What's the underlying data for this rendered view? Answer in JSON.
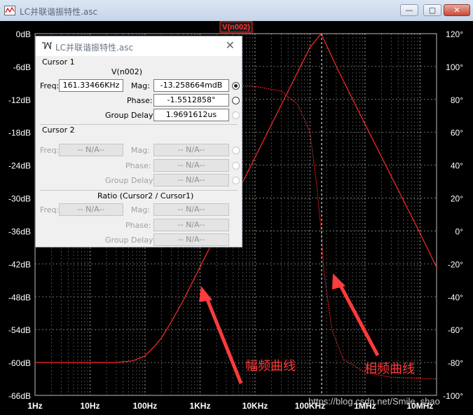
{
  "window": {
    "title": "LC并联谐振特性.asc"
  },
  "titlebar_buttons": {
    "minimize": "—",
    "maximize": "▢",
    "close": "✕"
  },
  "plot": {
    "trace_label": "V(n002)",
    "left_axis": [
      "0dB",
      "-6dB",
      "-12dB",
      "-18dB",
      "-24dB",
      "-30dB",
      "-36dB",
      "-42dB",
      "-48dB",
      "-54dB",
      "-60dB",
      "-66dB"
    ],
    "right_axis": [
      "120°",
      "100°",
      "80°",
      "60°",
      "40°",
      "20°",
      "0°",
      "-20°",
      "-40°",
      "-60°",
      "-80°",
      "-100°"
    ],
    "x_axis": [
      "1Hz",
      "10Hz",
      "100Hz",
      "1KHz",
      "10KHz",
      "100KHz",
      "1MHz",
      "10MHz"
    ],
    "annotations": {
      "mag": "幅频曲线",
      "phase": "相频曲线"
    },
    "watermark": "https://blog.csdn.net/Smile_shao",
    "colors": {
      "trace": "#ff2a2a",
      "annotation": "#ff3b3b",
      "grid": "#8a8a8a",
      "axis_text": "#ffffff"
    }
  },
  "chart_data": {
    "type": "line",
    "x_scale": "log",
    "xlim": [
      1,
      20000000
    ],
    "series": [
      {
        "axis": "left",
        "unit": "dB",
        "ylim": [
          -66,
          0
        ],
        "points": [
          [
            1,
            -60
          ],
          [
            10,
            -60
          ],
          [
            30,
            -60
          ],
          [
            60,
            -59.7
          ],
          [
            100,
            -58.8
          ],
          [
            150,
            -57
          ],
          [
            200,
            -55.5
          ],
          [
            300,
            -52.6
          ],
          [
            500,
            -48.6
          ],
          [
            1000,
            -42.6
          ],
          [
            3000,
            -33
          ],
          [
            10000,
            -22.6
          ],
          [
            30000,
            -13
          ],
          [
            100000,
            -2.5
          ],
          [
            160000,
            0
          ],
          [
            300000,
            -6
          ],
          [
            1000000,
            -16.5
          ],
          [
            3000000,
            -26
          ],
          [
            10000000,
            -36.4
          ],
          [
            20000000,
            -42.6
          ]
        ]
      },
      {
        "axis": "right",
        "unit": "°",
        "ylim": [
          -100,
          120
        ],
        "points": [
          [
            1,
            89.9
          ],
          [
            1000,
            89.9
          ],
          [
            10000,
            88
          ],
          [
            30000,
            85
          ],
          [
            60000,
            77
          ],
          [
            100000,
            60
          ],
          [
            130000,
            30
          ],
          [
            160000,
            0
          ],
          [
            180000,
            -25
          ],
          [
            250000,
            -60
          ],
          [
            400000,
            -78
          ],
          [
            1000000,
            -86
          ],
          [
            3000000,
            -89
          ],
          [
            20000000,
            -90
          ]
        ]
      }
    ]
  },
  "cursor_window": {
    "title": "LC并联谐振特性.asc",
    "close": "✕",
    "cursor1": {
      "header": "Cursor 1",
      "trace": "V(n002)",
      "freq_label": "Freq:",
      "freq": "161.33466KHz",
      "mag_label": "Mag:",
      "mag": "-13.258664mdB",
      "phase_label": "Phase:",
      "phase": "-1.5512858°",
      "gd_label": "Group Delay:",
      "gd": "1.9691612us"
    },
    "cursor2": {
      "header": "Cursor 2",
      "freq_label": "Freq:",
      "freq": "-- N/A--",
      "mag_label": "Mag:",
      "mag": "-- N/A--",
      "phase_label": "Phase:",
      "phase": "-- N/A--",
      "gd_label": "Group Delay:",
      "gd": "-- N/A--"
    },
    "ratio": {
      "header": "Ratio (Cursor2 / Cursor1)",
      "freq_label": "Freq:",
      "freq": "-- N/A--",
      "mag_label": "Mag:",
      "mag": "-- N/A--",
      "phase_label": "Phase:",
      "phase": "-- N/A--",
      "gd_label": "Group Delay:",
      "gd": "-- N/A--"
    }
  }
}
